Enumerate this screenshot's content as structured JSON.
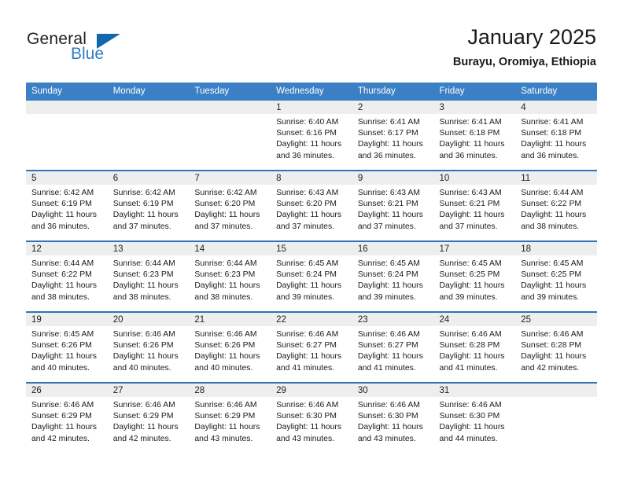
{
  "brand": {
    "name_top": "General",
    "name_bottom": "Blue",
    "accent_color": "#1567ac",
    "text_color": "#2e7cc4"
  },
  "header": {
    "month_title": "January 2025",
    "location": "Burayu, Oromiya, Ethiopia",
    "header_bar_color": "#3b7fc4",
    "row_divider_color": "#2e75b6",
    "daynum_band_color": "#eeeeee"
  },
  "weekdays": [
    "Sunday",
    "Monday",
    "Tuesday",
    "Wednesday",
    "Thursday",
    "Friday",
    "Saturday"
  ],
  "weeks": [
    [
      {
        "day": "",
        "empty": true
      },
      {
        "day": "",
        "empty": true
      },
      {
        "day": "",
        "empty": true
      },
      {
        "day": "1",
        "sunrise": "Sunrise: 6:40 AM",
        "sunset": "Sunset: 6:16 PM",
        "daylight": "Daylight: 11 hours and 36 minutes."
      },
      {
        "day": "2",
        "sunrise": "Sunrise: 6:41 AM",
        "sunset": "Sunset: 6:17 PM",
        "daylight": "Daylight: 11 hours and 36 minutes."
      },
      {
        "day": "3",
        "sunrise": "Sunrise: 6:41 AM",
        "sunset": "Sunset: 6:18 PM",
        "daylight": "Daylight: 11 hours and 36 minutes."
      },
      {
        "day": "4",
        "sunrise": "Sunrise: 6:41 AM",
        "sunset": "Sunset: 6:18 PM",
        "daylight": "Daylight: 11 hours and 36 minutes."
      }
    ],
    [
      {
        "day": "5",
        "sunrise": "Sunrise: 6:42 AM",
        "sunset": "Sunset: 6:19 PM",
        "daylight": "Daylight: 11 hours and 36 minutes."
      },
      {
        "day": "6",
        "sunrise": "Sunrise: 6:42 AM",
        "sunset": "Sunset: 6:19 PM",
        "daylight": "Daylight: 11 hours and 37 minutes."
      },
      {
        "day": "7",
        "sunrise": "Sunrise: 6:42 AM",
        "sunset": "Sunset: 6:20 PM",
        "daylight": "Daylight: 11 hours and 37 minutes."
      },
      {
        "day": "8",
        "sunrise": "Sunrise: 6:43 AM",
        "sunset": "Sunset: 6:20 PM",
        "daylight": "Daylight: 11 hours and 37 minutes."
      },
      {
        "day": "9",
        "sunrise": "Sunrise: 6:43 AM",
        "sunset": "Sunset: 6:21 PM",
        "daylight": "Daylight: 11 hours and 37 minutes."
      },
      {
        "day": "10",
        "sunrise": "Sunrise: 6:43 AM",
        "sunset": "Sunset: 6:21 PM",
        "daylight": "Daylight: 11 hours and 37 minutes."
      },
      {
        "day": "11",
        "sunrise": "Sunrise: 6:44 AM",
        "sunset": "Sunset: 6:22 PM",
        "daylight": "Daylight: 11 hours and 38 minutes."
      }
    ],
    [
      {
        "day": "12",
        "sunrise": "Sunrise: 6:44 AM",
        "sunset": "Sunset: 6:22 PM",
        "daylight": "Daylight: 11 hours and 38 minutes."
      },
      {
        "day": "13",
        "sunrise": "Sunrise: 6:44 AM",
        "sunset": "Sunset: 6:23 PM",
        "daylight": "Daylight: 11 hours and 38 minutes."
      },
      {
        "day": "14",
        "sunrise": "Sunrise: 6:44 AM",
        "sunset": "Sunset: 6:23 PM",
        "daylight": "Daylight: 11 hours and 38 minutes."
      },
      {
        "day": "15",
        "sunrise": "Sunrise: 6:45 AM",
        "sunset": "Sunset: 6:24 PM",
        "daylight": "Daylight: 11 hours and 39 minutes."
      },
      {
        "day": "16",
        "sunrise": "Sunrise: 6:45 AM",
        "sunset": "Sunset: 6:24 PM",
        "daylight": "Daylight: 11 hours and 39 minutes."
      },
      {
        "day": "17",
        "sunrise": "Sunrise: 6:45 AM",
        "sunset": "Sunset: 6:25 PM",
        "daylight": "Daylight: 11 hours and 39 minutes."
      },
      {
        "day": "18",
        "sunrise": "Sunrise: 6:45 AM",
        "sunset": "Sunset: 6:25 PM",
        "daylight": "Daylight: 11 hours and 39 minutes."
      }
    ],
    [
      {
        "day": "19",
        "sunrise": "Sunrise: 6:45 AM",
        "sunset": "Sunset: 6:26 PM",
        "daylight": "Daylight: 11 hours and 40 minutes."
      },
      {
        "day": "20",
        "sunrise": "Sunrise: 6:46 AM",
        "sunset": "Sunset: 6:26 PM",
        "daylight": "Daylight: 11 hours and 40 minutes."
      },
      {
        "day": "21",
        "sunrise": "Sunrise: 6:46 AM",
        "sunset": "Sunset: 6:26 PM",
        "daylight": "Daylight: 11 hours and 40 minutes."
      },
      {
        "day": "22",
        "sunrise": "Sunrise: 6:46 AM",
        "sunset": "Sunset: 6:27 PM",
        "daylight": "Daylight: 11 hours and 41 minutes."
      },
      {
        "day": "23",
        "sunrise": "Sunrise: 6:46 AM",
        "sunset": "Sunset: 6:27 PM",
        "daylight": "Daylight: 11 hours and 41 minutes."
      },
      {
        "day": "24",
        "sunrise": "Sunrise: 6:46 AM",
        "sunset": "Sunset: 6:28 PM",
        "daylight": "Daylight: 11 hours and 41 minutes."
      },
      {
        "day": "25",
        "sunrise": "Sunrise: 6:46 AM",
        "sunset": "Sunset: 6:28 PM",
        "daylight": "Daylight: 11 hours and 42 minutes."
      }
    ],
    [
      {
        "day": "26",
        "sunrise": "Sunrise: 6:46 AM",
        "sunset": "Sunset: 6:29 PM",
        "daylight": "Daylight: 11 hours and 42 minutes."
      },
      {
        "day": "27",
        "sunrise": "Sunrise: 6:46 AM",
        "sunset": "Sunset: 6:29 PM",
        "daylight": "Daylight: 11 hours and 42 minutes."
      },
      {
        "day": "28",
        "sunrise": "Sunrise: 6:46 AM",
        "sunset": "Sunset: 6:29 PM",
        "daylight": "Daylight: 11 hours and 43 minutes."
      },
      {
        "day": "29",
        "sunrise": "Sunrise: 6:46 AM",
        "sunset": "Sunset: 6:30 PM",
        "daylight": "Daylight: 11 hours and 43 minutes."
      },
      {
        "day": "30",
        "sunrise": "Sunrise: 6:46 AM",
        "sunset": "Sunset: 6:30 PM",
        "daylight": "Daylight: 11 hours and 43 minutes."
      },
      {
        "day": "31",
        "sunrise": "Sunrise: 6:46 AM",
        "sunset": "Sunset: 6:30 PM",
        "daylight": "Daylight: 11 hours and 44 minutes."
      },
      {
        "day": "",
        "empty": true
      }
    ]
  ]
}
